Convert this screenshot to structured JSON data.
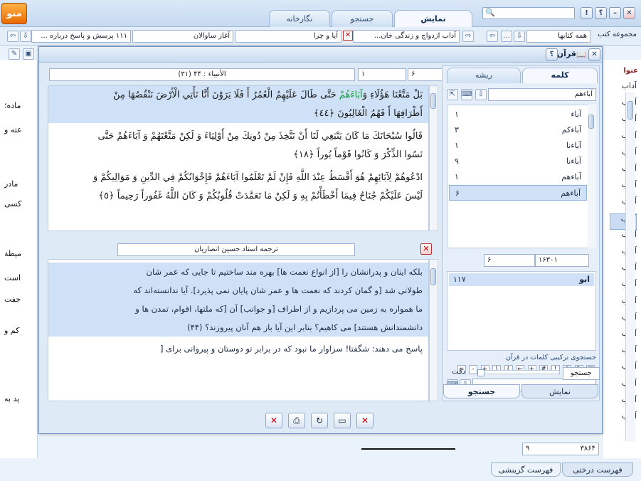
{
  "app": {
    "logo": "منو"
  },
  "tabs": {
    "display": "نمایش",
    "search": "جستجو",
    "writing": "نگارخانه"
  },
  "window_buttons": {
    "close": "✕",
    "help": "؟",
    "info": "!",
    "min": "–",
    "help2": "؟"
  },
  "toolbar2": {
    "collection_label": "مجموعه کتب",
    "collection_value": "همه کتابها",
    "field1": "آداب ازدواج و زندگی خان...",
    "field2": "آیا و چرا",
    "field3": "آغاز ساوالان",
    "field4": "۱۱۱ پرسش و پاسخ درباره ..."
  },
  "background": {
    "col_header": "عنوا",
    "list_item": "آداب",
    "list_count": 21,
    "selected_index": 8,
    "left_fragments": [
      "ماده؛",
      "عته و",
      "مادر",
      "کسی",
      "میطة",
      "است",
      "جفت",
      "کم و",
      "ید به"
    ],
    "footer": {
      "count_a": "۹",
      "count_b": "۳۸۶۴",
      "tab_tree": "فهرست درختی",
      "tab_selective": "فهرست گزینشی"
    }
  },
  "dialog": {
    "title": "قرآن",
    "ref": {
      "surah": "(۳۱) الأنبياء : ۴۴",
      "aya_from": "۱",
      "aya_to": "۶"
    },
    "quran_lines": [
      {
        "text_a": "بَلْ مَتَّعْنَا هَؤُلَاءِ وَ",
        "text_green": "آبَاءَهُمْ",
        "text_b": " حَتَّى طَالَ عَلَيْهِمُ الْعُمُرُ أَ فَلَا يَرَوْنَ أَنَّا نَأْتِي الْأَرْضَ نَنْقُصُهَا مِنْ",
        "hl": true
      },
      {
        "text_a": "أَطْرَافِهَا أَ فَهُمُ الْغَالِبُونَ ﴿٤٤﴾",
        "text_green": "",
        "text_b": "",
        "hl": true
      },
      {
        "text_a": "قَالُوا سُبْحَانَكَ مَا كَانَ يَنْبَغِي لَنَا أَنْ نَتَّخِذَ مِنْ دُونِكَ مِنْ أَوْلِيَاءَ وَ لَكِنْ مَتَّعْتَهُمْ وَ آبَاءَهُمْ حَتَّى",
        "text_green": "",
        "text_b": "",
        "hl": false
      },
      {
        "text_a": "نَسُوا الذِّكْرَ وَ كَانُوا قَوْماً بُوراً ﴿١٨﴾",
        "text_green": "",
        "text_b": "",
        "hl": false
      },
      {
        "text_a": "ادْعُوهُمْ لِآبَائِهِمْ هُوَ أَقْسَطُ عِنْدَ اللَّهِ فَإِنْ لَمْ تَعْلَمُوا آبَاءَهُمْ فَإِخْوَانُكُمْ فِي الدِّينِ وَ مَوَالِيكُمْ وَ",
        "text_green": "",
        "text_b": "",
        "hl": false
      },
      {
        "text_a": "لَيْسَ عَلَيْكُمْ جُنَاحٌ فِيمَا أَخْطَأْتُمْ بِهِ وَ لَكِنْ مَا تَعَمَّدَتْ قُلُوبُكُمْ وَ كَانَ اللَّهُ غَفُوراً رَحِيماً ﴿٥﴾",
        "text_green": "",
        "text_b": "",
        "hl": false
      }
    ],
    "translator": "ترجمه استاد حسین انصاریان",
    "translation_lines": [
      {
        "text": "بلکه اینان و پدرانشان را [از انواع نعمت ها] بهره مند ساختیم تا جایی که عمر شان",
        "hl": true
      },
      {
        "text": "طولانی شد [و گمان کردند که نعمت ها و عمر شان پایان نمی پذیرد]. آیا ندانسته‌اند که",
        "hl": true
      },
      {
        "text": "ما همواره به زمین می پردازیم و از اطراف [و جوانب] آن [که ملتها، اقوام، تمدن ها و",
        "hl": true
      },
      {
        "text": "دانشمندانش هستند] می کاهیم؟ بنابر این آیا باز هم آنان پیروزند؟ (۴۴)",
        "hl": true
      },
      {
        "text": "پاسخ می دهند: شگفتا! سزاوار ما نبود که در برابر تو دوستان و پیروانی برای [",
        "hl": false
      }
    ],
    "side": {
      "tab_word": "کلمه",
      "tab_root": "ریشه",
      "search_value": "آباءهم",
      "words": [
        {
          "w": "آباء",
          "n": "۱"
        },
        {
          "w": "آباءکم",
          "n": "۳"
        },
        {
          "w": "آباءنا",
          "n": "۱"
        },
        {
          "w": "آباءنا",
          "n": "۹"
        },
        {
          "w": "آباءهم",
          "n": "۱"
        },
        {
          "w": "آباءهم",
          "n": "۶"
        }
      ],
      "selected_word": 5,
      "nav_a": "۶",
      "nav_b": "۱۶۳۰۱",
      "root_rows": [
        {
          "w": "ابو",
          "n": "۱۱۷"
        }
      ],
      "combo_title": "جستجوی ترکیبی کلمات در قرآن",
      "ops": [
        "□",
        "&",
        "|",
        "!",
        "#",
        "+",
        "←",
        "(",
        ")",
        "+",
        "-",
        "="
      ],
      "search_btn": "جستجو",
      "exact_label": "دقت",
      "bottom_tab_display": "نمایش",
      "bottom_tab_search": "جستجو"
    },
    "bottom_buttons": [
      "✕",
      "⎙",
      "↻",
      "▭",
      "✕"
    ]
  }
}
